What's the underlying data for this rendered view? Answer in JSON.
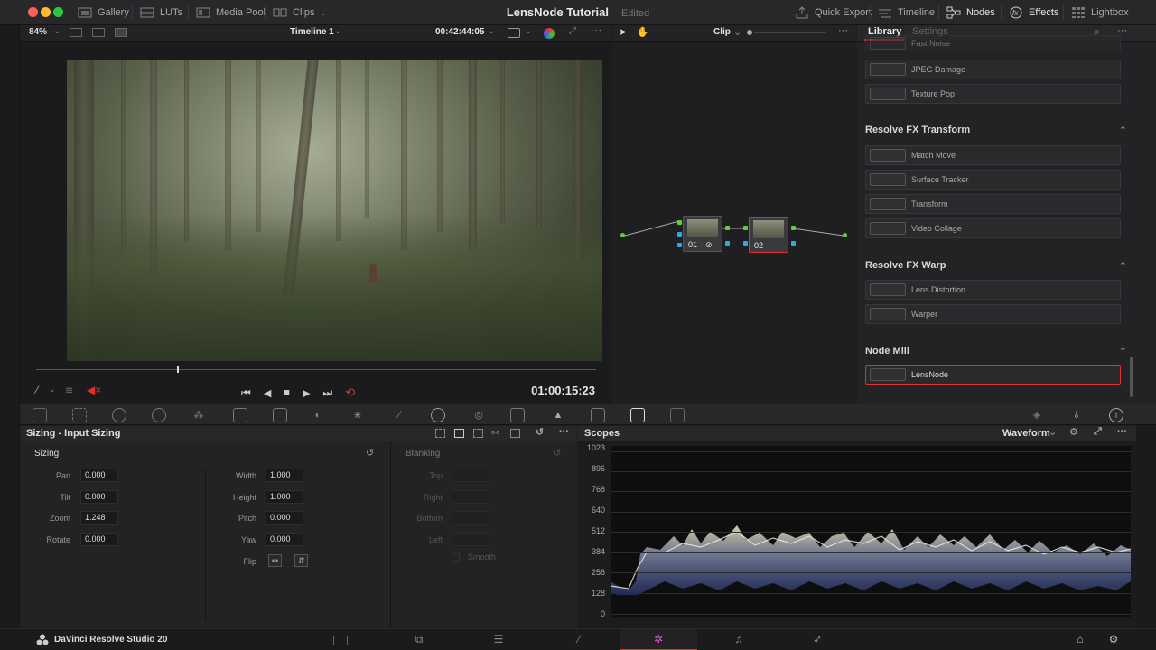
{
  "window": {
    "title": "LensNode Tutorial",
    "status": "Edited"
  },
  "topbar": {
    "left": [
      {
        "label": "Gallery",
        "icon": "gallery-icon"
      },
      {
        "label": "LUTs",
        "icon": "luts-icon"
      },
      {
        "label": "Media Pool",
        "icon": "media-pool-icon"
      },
      {
        "label": "Clips",
        "icon": "clips-icon"
      }
    ],
    "right": [
      {
        "label": "Quick Export",
        "icon": "export-icon"
      },
      {
        "label": "Timeline",
        "icon": "timeline-icon"
      },
      {
        "label": "Nodes",
        "icon": "nodes-icon"
      },
      {
        "label": "Effects",
        "icon": "fx-icon"
      },
      {
        "label": "Lightbox",
        "icon": "lightbox-icon"
      }
    ]
  },
  "viewer": {
    "zoom": "84%",
    "timeline": "Timeline 1",
    "timecode": "00:42:44:05",
    "playback_timecode": "01:00:15:23"
  },
  "nodes": {
    "mode": "Clip",
    "node1_label": "01",
    "node2_label": "02"
  },
  "library": {
    "tab_library": "Library",
    "tab_settings": "Settings",
    "items_top": [
      "Fast Noise",
      "JPEG Damage",
      "Texture Pop"
    ],
    "section_transform": "Resolve FX Transform",
    "items_transform": [
      "Match Move",
      "Surface Tracker",
      "Transform",
      "Video Collage"
    ],
    "section_warp": "Resolve FX Warp",
    "items_warp": [
      "Lens Distortion",
      "Warper"
    ],
    "section_nodemill": "Node Mill",
    "items_nodemill": [
      "LensNode"
    ]
  },
  "sizing": {
    "title": "Sizing - Input Sizing",
    "section": "Sizing",
    "pan_label": "Pan",
    "pan": "0.000",
    "tilt_label": "Tilt",
    "tilt": "0.000",
    "zoom_label": "Zoom",
    "zoom": "1.248",
    "rotate_label": "Rotate",
    "rotate": "0.000",
    "width_label": "Width",
    "width": "1.000",
    "height_label": "Height",
    "height": "1.000",
    "pitch_label": "Pitch",
    "pitch": "0.000",
    "yaw_label": "Yaw",
    "yaw": "0.000",
    "flip_label": "Flip",
    "blanking": "Blanking",
    "top_label": "Top",
    "right_label": "Right",
    "bottom_label": "Bottom",
    "left_label": "Left",
    "smooth_label": "Smooth"
  },
  "scopes": {
    "title": "Scopes",
    "mode": "Waveform",
    "scale": [
      "1023",
      "896",
      "768",
      "640",
      "512",
      "384",
      "256",
      "128",
      "0"
    ]
  },
  "footer": {
    "app_name": "DaVinci Resolve Studio 20"
  },
  "colors": {
    "accent_red": "#e03030",
    "node_green": "#5bd23c",
    "node_blue": "#2fa8e6"
  }
}
